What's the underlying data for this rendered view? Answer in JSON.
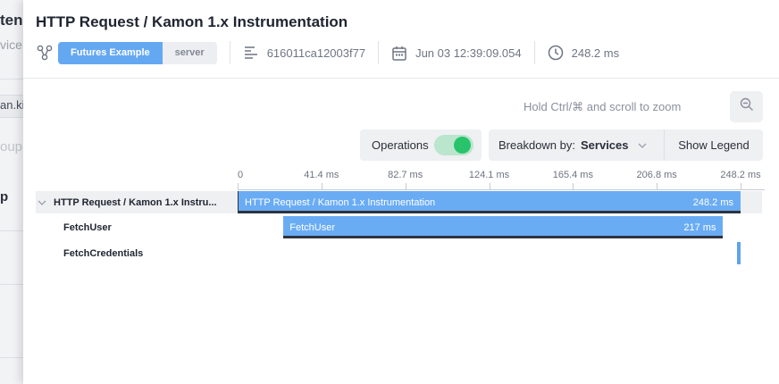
{
  "background": {
    "fragments": [
      "tenc",
      "vice",
      "an.kin",
      "oup",
      "p"
    ]
  },
  "drawer": {
    "title": "HTTP Request / Kamon 1.x Instrumentation",
    "service_tabs": [
      {
        "label": "Futures Example",
        "active": true
      },
      {
        "label": "server",
        "active": false
      }
    ],
    "trace_id": "616011ca12003f77",
    "timestamp": "Jun 03 12:39:09.054",
    "duration": "248.2 ms"
  },
  "controls": {
    "zoom_hint": "Hold Ctrl/⌘ and scroll to zoom",
    "operations_label": "Operations",
    "operations_enabled": true,
    "breakdown_label": "Breakdown by:",
    "breakdown_value": "Services",
    "show_legend_label": "Show Legend"
  },
  "timeline": {
    "ticks": [
      "0",
      "41.4 ms",
      "82.7 ms",
      "124.1 ms",
      "165.4 ms",
      "206.8 ms",
      "248.2 ms"
    ],
    "total_ms": 248.2,
    "spans": [
      {
        "label": "HTTP Request / Kamon 1.x Instrumentation",
        "row_label": "HTTP Request / Kamon 1.x Instru...",
        "start_ms": 0,
        "duration_ms": 248.2,
        "duration_text": "248.2 ms",
        "level": 0
      },
      {
        "label": "FetchUser",
        "row_label": "FetchUser",
        "start_ms": 22.6,
        "duration_ms": 217,
        "duration_text": "217 ms",
        "level": 1
      },
      {
        "label": "",
        "row_label": "FetchCredentials",
        "start_ms": 246.6,
        "duration_ms": 1.6,
        "duration_text": "",
        "level": 1
      }
    ]
  },
  "colors": {
    "accent": "#65a8f2",
    "span_bar": "#6aacf4",
    "toggle_on": "#28c36b",
    "toggle_track": "#b9e6cc"
  },
  "icons": {
    "service": "service-graph-icon",
    "trace": "list-lines-icon",
    "date": "calendar-icon",
    "duration": "clock-icon",
    "zoom": "zoom-out-icon",
    "breakdown": "chevron-down-icon",
    "collapse": "caret-down-icon"
  }
}
